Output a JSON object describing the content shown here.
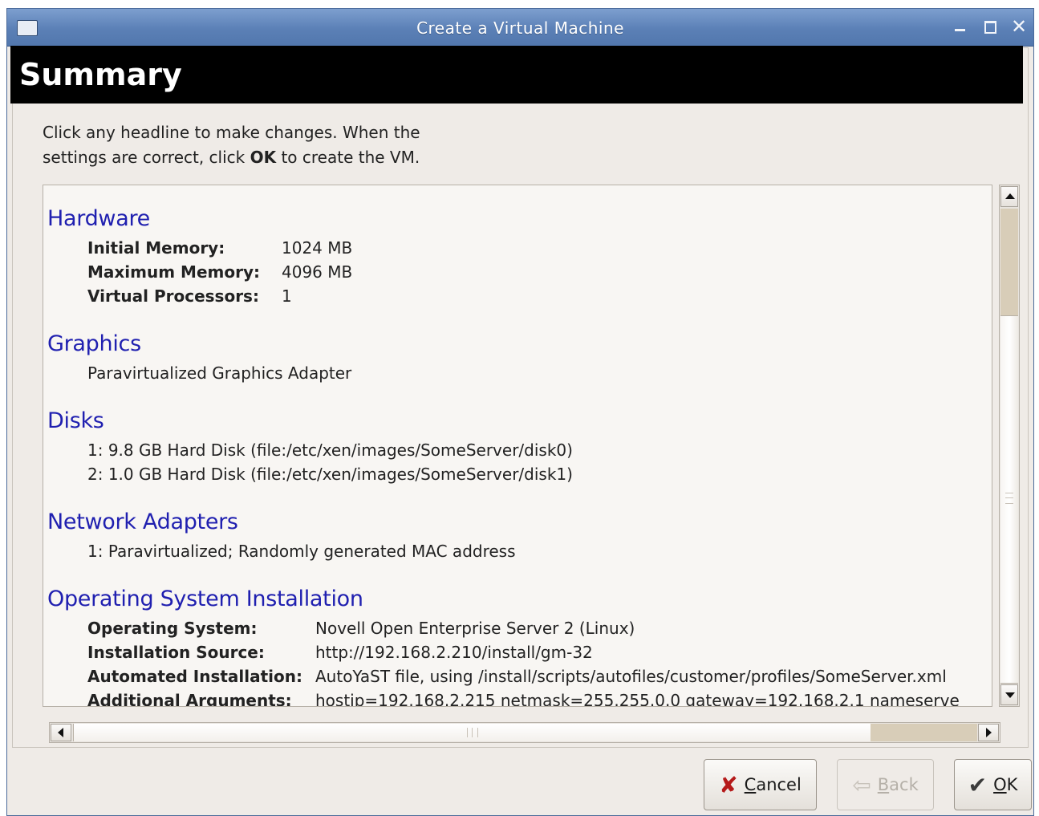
{
  "window": {
    "title": "Create a Virtual Machine"
  },
  "banner": {
    "title": "Summary"
  },
  "intro": {
    "line1": "Click any headline to make changes.  When the",
    "line2_pre": "settings are correct, click ",
    "line2_bold": "OK",
    "line2_post": " to create the VM."
  },
  "hardware": {
    "heading": "Hardware",
    "rows": [
      {
        "label": "Initial Memory:",
        "value": "1024 MB"
      },
      {
        "label": "Maximum Memory:",
        "value": "4096 MB"
      },
      {
        "label": "Virtual Processors:",
        "value": "1"
      }
    ]
  },
  "graphics": {
    "heading": "Graphics",
    "value": "Paravirtualized Graphics Adapter"
  },
  "disks": {
    "heading": "Disks",
    "items": [
      "1: 9.8 GB Hard Disk (file:/etc/xen/images/SomeServer/disk0)",
      "2: 1.0 GB Hard Disk (file:/etc/xen/images/SomeServer/disk1)"
    ]
  },
  "network": {
    "heading": "Network Adapters",
    "items": [
      "1: Paravirtualized; Randomly generated MAC address"
    ]
  },
  "os": {
    "heading": "Operating System Installation",
    "rows": [
      {
        "label": "Operating System:",
        "value": "Novell Open Enterprise Server 2 (Linux)"
      },
      {
        "label": "Installation Source:",
        "value": "http://192.168.2.210/install/gm-32"
      },
      {
        "label": "Automated Installation:",
        "value": "AutoYaST file, using /install/scripts/autofiles/customer/profiles/SomeServer.xml"
      },
      {
        "label": "Additional Arguments:",
        "value": "hostip=192.168.2.215 netmask=255.255.0.0 gateway=192.168.2.1 nameserve"
      }
    ]
  },
  "buttons": {
    "cancel_pre": "",
    "cancel_mnemonic": "C",
    "cancel_post": "ancel",
    "back_mnemonic": "B",
    "back_post": "ack",
    "ok_mnemonic": "O",
    "ok_post": "K"
  }
}
